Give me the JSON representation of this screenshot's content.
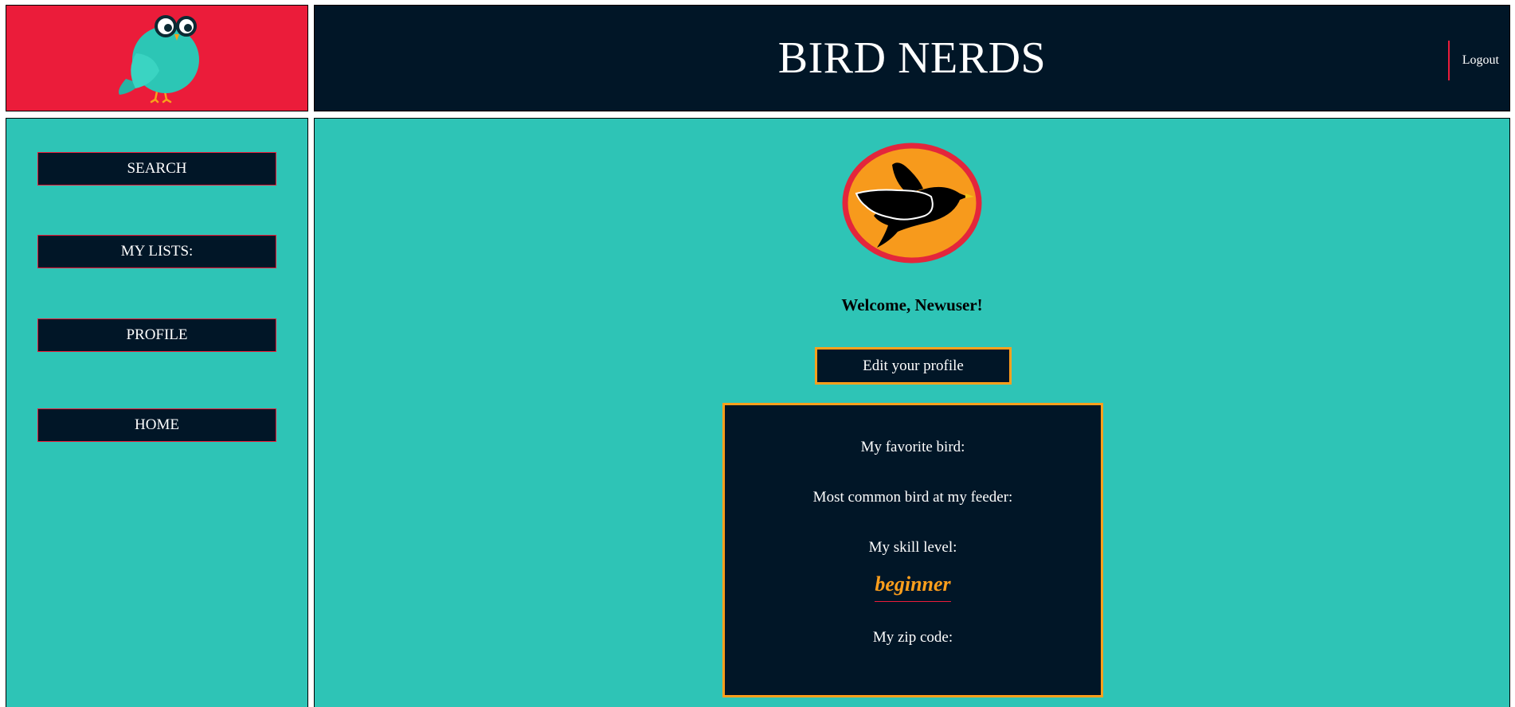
{
  "header": {
    "title": "BIRD NERDS",
    "logout_label": "Logout"
  },
  "sidebar": {
    "items": [
      {
        "label": "SEARCH"
      },
      {
        "label": "MY LISTS:"
      },
      {
        "label": "PROFILE"
      },
      {
        "label": "HOME"
      }
    ]
  },
  "main": {
    "welcome": "Welcome, Newuser!",
    "edit_profile_label": "Edit your profile",
    "profile": {
      "favorite_bird_label": "My favorite bird:",
      "feeder_bird_label": "Most common bird at my feeder:",
      "skill_label": "My skill level:",
      "skill_value": "beginner",
      "zip_label": "My zip code:"
    }
  },
  "colors": {
    "brand_red": "#eb1c3a",
    "navy": "#011627",
    "teal": "#2ec4b6",
    "orange": "#ff9f1c"
  },
  "icons": {
    "logo": "owl-bird-with-glasses-icon",
    "profile_badge": "flying-bird-badge-icon"
  }
}
